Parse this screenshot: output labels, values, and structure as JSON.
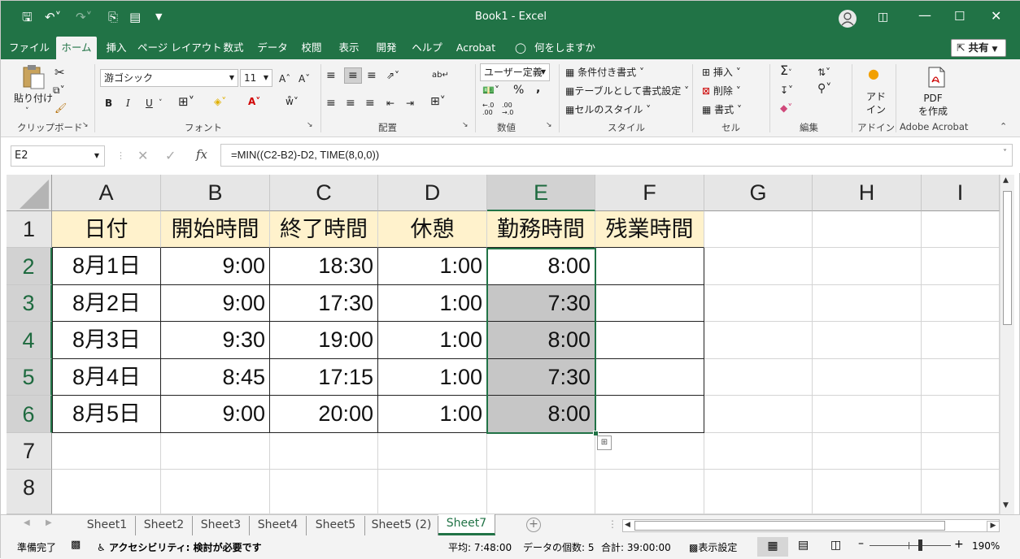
{
  "window": {
    "title": "Book1 - Excel",
    "minimize_icon": "minimize-icon",
    "restore_icon": "restore-icon",
    "close_icon": "close-icon"
  },
  "qat": {
    "save": "save-icon",
    "undo": "undo-icon",
    "redo": "redo-icon",
    "print": "print-preview-icon",
    "form": "form-icon",
    "more": "customize-icon"
  },
  "tabs": [
    "ファイル",
    "ホーム",
    "挿入",
    "ページ レイアウト",
    "数式",
    "データ",
    "校閲",
    "表示",
    "開発",
    "ヘルプ",
    "Acrobat"
  ],
  "tell_me": "何をしますか",
  "share": "共有",
  "ribbon": {
    "clipboard": {
      "paste": "貼り付け",
      "group": "クリップボード"
    },
    "font": {
      "name": "游ゴシック",
      "size": "11",
      "group": "フォント",
      "bold": "B",
      "italic": "I",
      "underline": "U"
    },
    "alignment": {
      "group": "配置"
    },
    "number": {
      "format": "ユーザー定義",
      "percent": "%",
      "comma": ",",
      "group": "数値"
    },
    "styles": {
      "conditional": "条件付き書式",
      "table": "テーブルとして書式設定",
      "cell": "セルのスタイル",
      "group": "スタイル"
    },
    "cells": {
      "insert": "挿入",
      "delete": "削除",
      "format": "書式",
      "group": "セル"
    },
    "editing": {
      "group": "編集"
    },
    "addins": {
      "label": "アド\nイン",
      "group": "アドイン"
    },
    "acrobat": {
      "label": "PDF\nを作成",
      "group": "Adobe Acrobat"
    }
  },
  "formula_bar": {
    "name_box": "E2",
    "fx": "fx",
    "formula": "=MIN((C2-B2)-D2, TIME(8,0,0))"
  },
  "columns": [
    "A",
    "B",
    "C",
    "D",
    "E",
    "F",
    "G",
    "H",
    "I"
  ],
  "rows": [
    "1",
    "2",
    "3",
    "4",
    "5",
    "6",
    "7",
    "8"
  ],
  "grid": {
    "header": [
      "日付",
      "開始時間",
      "終了時間",
      "休憩",
      "勤務時間",
      "残業時間"
    ],
    "data": [
      [
        "8月1日",
        "9:00",
        "18:30",
        "1:00",
        "8:00",
        ""
      ],
      [
        "8月2日",
        "9:00",
        "17:30",
        "1:00",
        "7:30",
        ""
      ],
      [
        "8月3日",
        "9:30",
        "19:00",
        "1:00",
        "8:00",
        ""
      ],
      [
        "8月4日",
        "8:45",
        "17:15",
        "1:00",
        "7:30",
        ""
      ],
      [
        "8月5日",
        "9:00",
        "20:00",
        "1:00",
        "8:00",
        ""
      ]
    ]
  },
  "sheets": [
    "Sheet1",
    "Sheet2",
    "Sheet3",
    "Sheet4",
    "Sheet5",
    "Sheet5 (2)",
    "Sheet7"
  ],
  "active_sheet": "Sheet7",
  "status": {
    "ready": "準備完了",
    "accessibility": "アクセシビリティ: 検討が必要です",
    "average": "平均: 7:48:00",
    "count": "データの個数: 5",
    "sum": "合計: 39:00:00",
    "display_settings": "表示設定",
    "zoom": "190%"
  },
  "colors": {
    "accent": "#217346",
    "header_fill": "#fff2cc",
    "selected_fill": "#c6c6c6"
  }
}
